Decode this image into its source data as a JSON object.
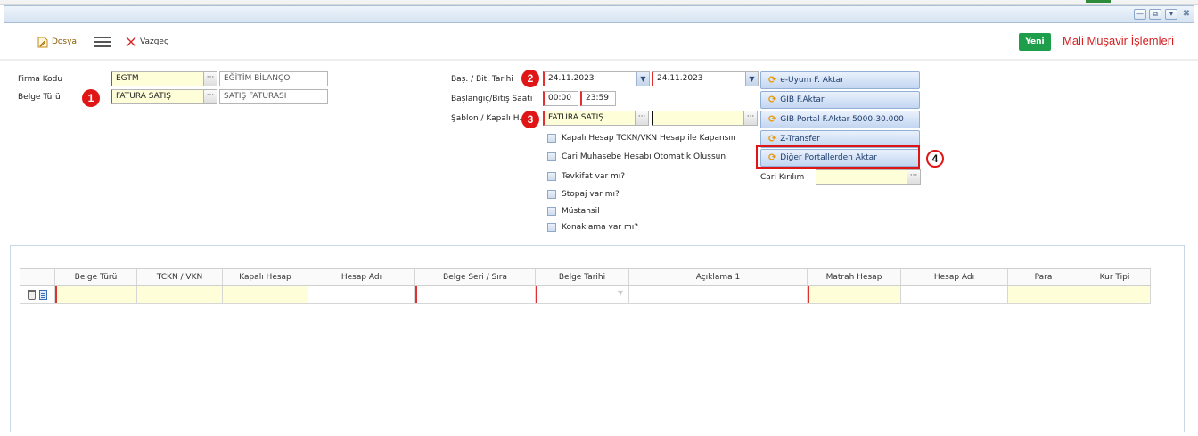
{
  "toolbar": {
    "dosya": "Dosya",
    "vazgec": "Vazgeç",
    "yeni": "Yeni",
    "title": "Mali Müşavir İşlemleri"
  },
  "form": {
    "firma_kodu_label": "Firma Kodu",
    "firma_kodu_value": "EGTM",
    "firma_kodu_desc": "EĞİTİM BİLANÇO",
    "belge_turu_label": "Belge Türü",
    "belge_turu_value": "FATURA SATIŞ",
    "belge_turu_desc": "SATIŞ FATURASI",
    "bas_bit_tarihi_label": "Baş. / Bit. Tarihi",
    "bas_tarihi": "24.11.2023",
    "bit_tarihi": "24.11.2023",
    "saat_label": "Başlangıç/Bitiş Saati",
    "bas_saat": "00:00",
    "bit_saat": "23:59",
    "sablon_label": "Şablon / Kapalı H.",
    "sablon_value": "FATURA SATIŞ",
    "kapali_h_value": "",
    "cari_kirilim_label": "Cari Kırılım",
    "cari_kirilim_value": ""
  },
  "checkboxes": [
    "Kapalı Hesap TCKN/VKN Hesap ile Kapansın",
    "Cari Muhasebe Hesabı Otomatik Oluşsun",
    "Tevkifat var mı?",
    "Stopaj var mı?",
    "Müstahsil",
    "Konaklama var mı?"
  ],
  "actions": [
    "e-Uyum F. Aktar",
    "GIB F.Aktar",
    "GIB Portal F.Aktar 5000-30.000",
    "Z-Transfer",
    "Diğer Portallerden Aktar"
  ],
  "badges": [
    "1",
    "2",
    "3",
    "4"
  ],
  "grid": {
    "columns": [
      "Belge Türü",
      "TCKN / VKN",
      "Kapalı Hesap",
      "Hesap Adı",
      "Belge Seri / Sıra",
      "Belge Tarihi",
      "Açıklama 1",
      "Matrah Hesap",
      "Hesap Adı",
      "Para",
      "Kur Tipi"
    ]
  },
  "icons": {
    "dosya": "edit-document-icon",
    "menu": "hamburger-menu-icon",
    "vazgec": "close-x-icon",
    "action": "refresh-icon",
    "row_delete": "trash-icon",
    "row_doc": "document-icon"
  },
  "colors": {
    "accent_red": "#e01515",
    "title_red": "#d42020",
    "yeni_green": "#1e9e4a",
    "required_yellow": "#fefed8",
    "button_blue": "#c3d6f1"
  }
}
